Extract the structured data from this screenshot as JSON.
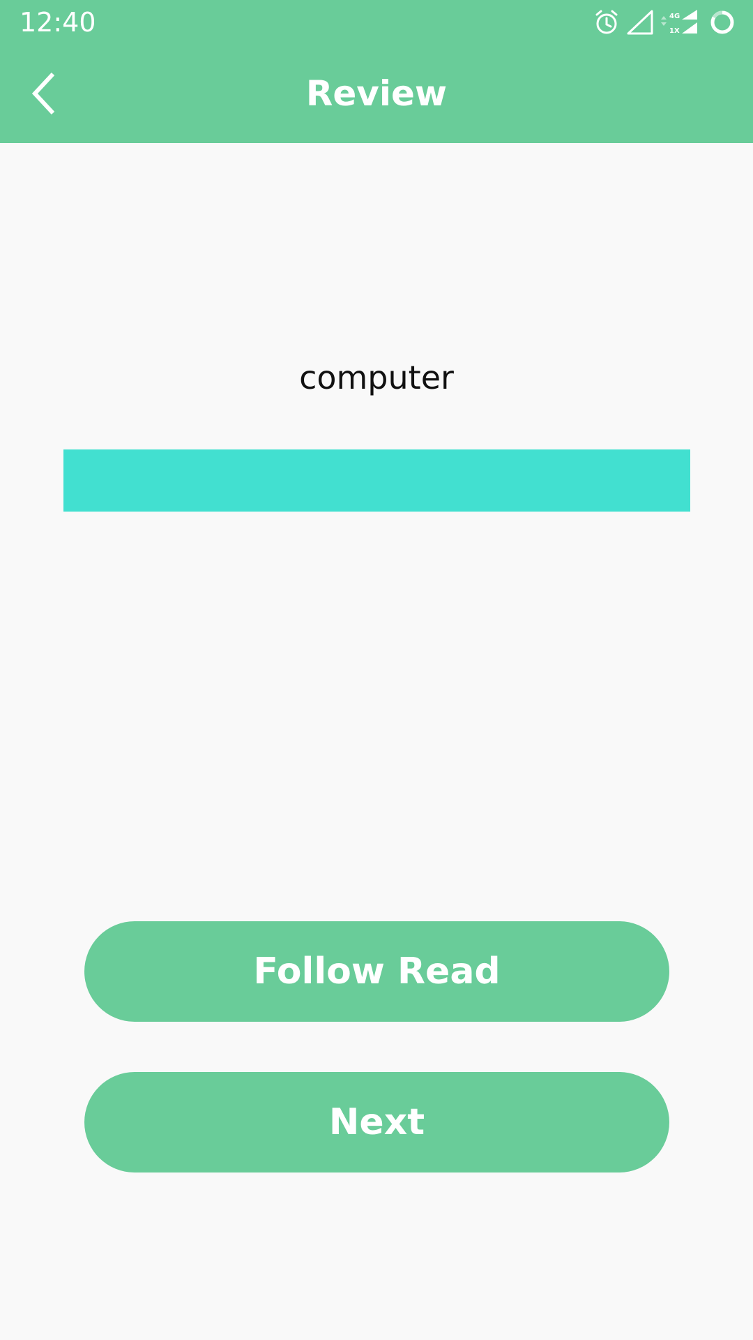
{
  "status_bar": {
    "time": "12:40",
    "icons": [
      "alarm-icon",
      "signal-empty-icon",
      "network-4g-1x-icon",
      "battery-ring-icon"
    ],
    "network_label_top": "4G",
    "network_label_bottom": "1X"
  },
  "app_bar": {
    "title": "Review",
    "back_icon": "chevron-left-icon"
  },
  "content": {
    "word": "computer"
  },
  "buttons": {
    "follow_read": "Follow Read",
    "next": "Next"
  },
  "colors": {
    "primary": "#69cc99",
    "answer_bar": "#42e0d0",
    "background": "#f9f9f9"
  }
}
